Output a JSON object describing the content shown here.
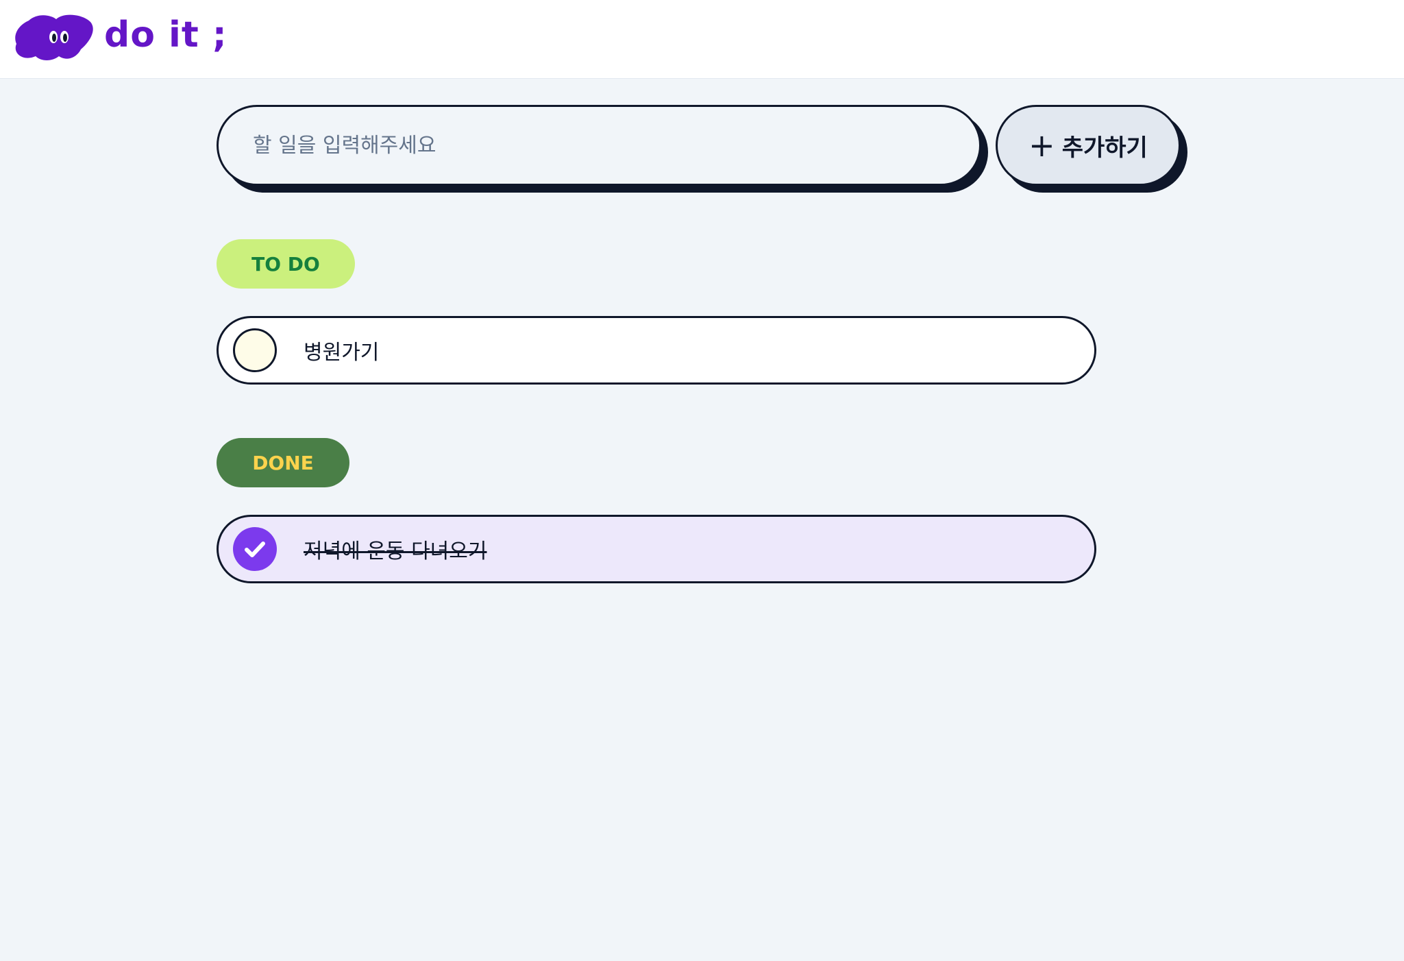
{
  "header": {
    "logo_text": "do it ;",
    "brand_color": "#6416c7",
    "logo_icon": "purple-blob-with-eyes"
  },
  "input": {
    "placeholder": "할 일을 입력해주세요",
    "value": ""
  },
  "add_button": {
    "plus": "+",
    "label": "추가하기"
  },
  "sections": {
    "todo": {
      "label": "TO DO",
      "items": [
        {
          "text": "병원가기",
          "checked": false
        }
      ]
    },
    "done": {
      "label": "DONE",
      "items": [
        {
          "text": "저녁에 운동 다녀오기",
          "checked": true
        }
      ]
    }
  },
  "colors": {
    "background": "#f1f5f9",
    "todo_badge": "#cbf07d",
    "done_badge": "#4a7f47",
    "checked": "#7c3aed",
    "done_item_bg": "#ede8fb"
  }
}
